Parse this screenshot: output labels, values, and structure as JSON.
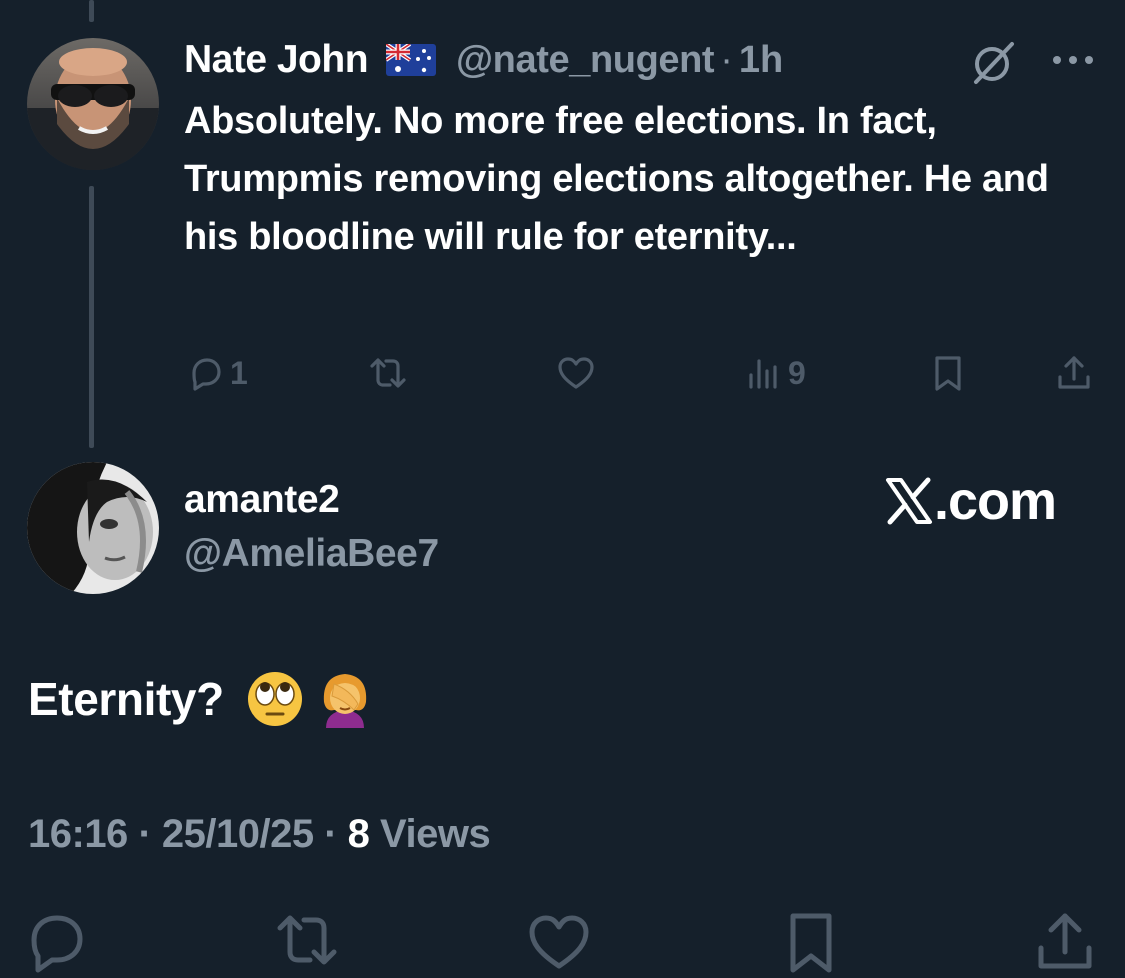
{
  "parent_tweet": {
    "author_name": "Nate John",
    "author_flag": "australia-flag",
    "handle": "@nate_nugent",
    "separator": "·",
    "time": "1h",
    "text": "Absolutely. No more free elections. In fact, Trumpmis removing elections altogether. He and his bloodline will rule for eternity...",
    "actions": {
      "reply_count": "1",
      "views_count": "9"
    }
  },
  "reply_tweet": {
    "author_name": "amante2",
    "handle": "@AmeliaBee7",
    "text": "Eternity?",
    "emojis": [
      "face-with-rolling-eyes",
      "woman-facepalming"
    ],
    "timestamp_time": "16:16",
    "timestamp_sep1": "·",
    "timestamp_date": "25/10/25",
    "timestamp_sep2": "·",
    "views_count": "8",
    "views_label": "Views"
  },
  "watermark": {
    "text": ".com",
    "logo": "x-logo"
  },
  "colors": {
    "background": "#15202b",
    "primary_text": "#ffffff",
    "secondary_text": "#8b98a5",
    "icon_dim": "#4e5b69",
    "thread_line": "#3e4a57"
  }
}
